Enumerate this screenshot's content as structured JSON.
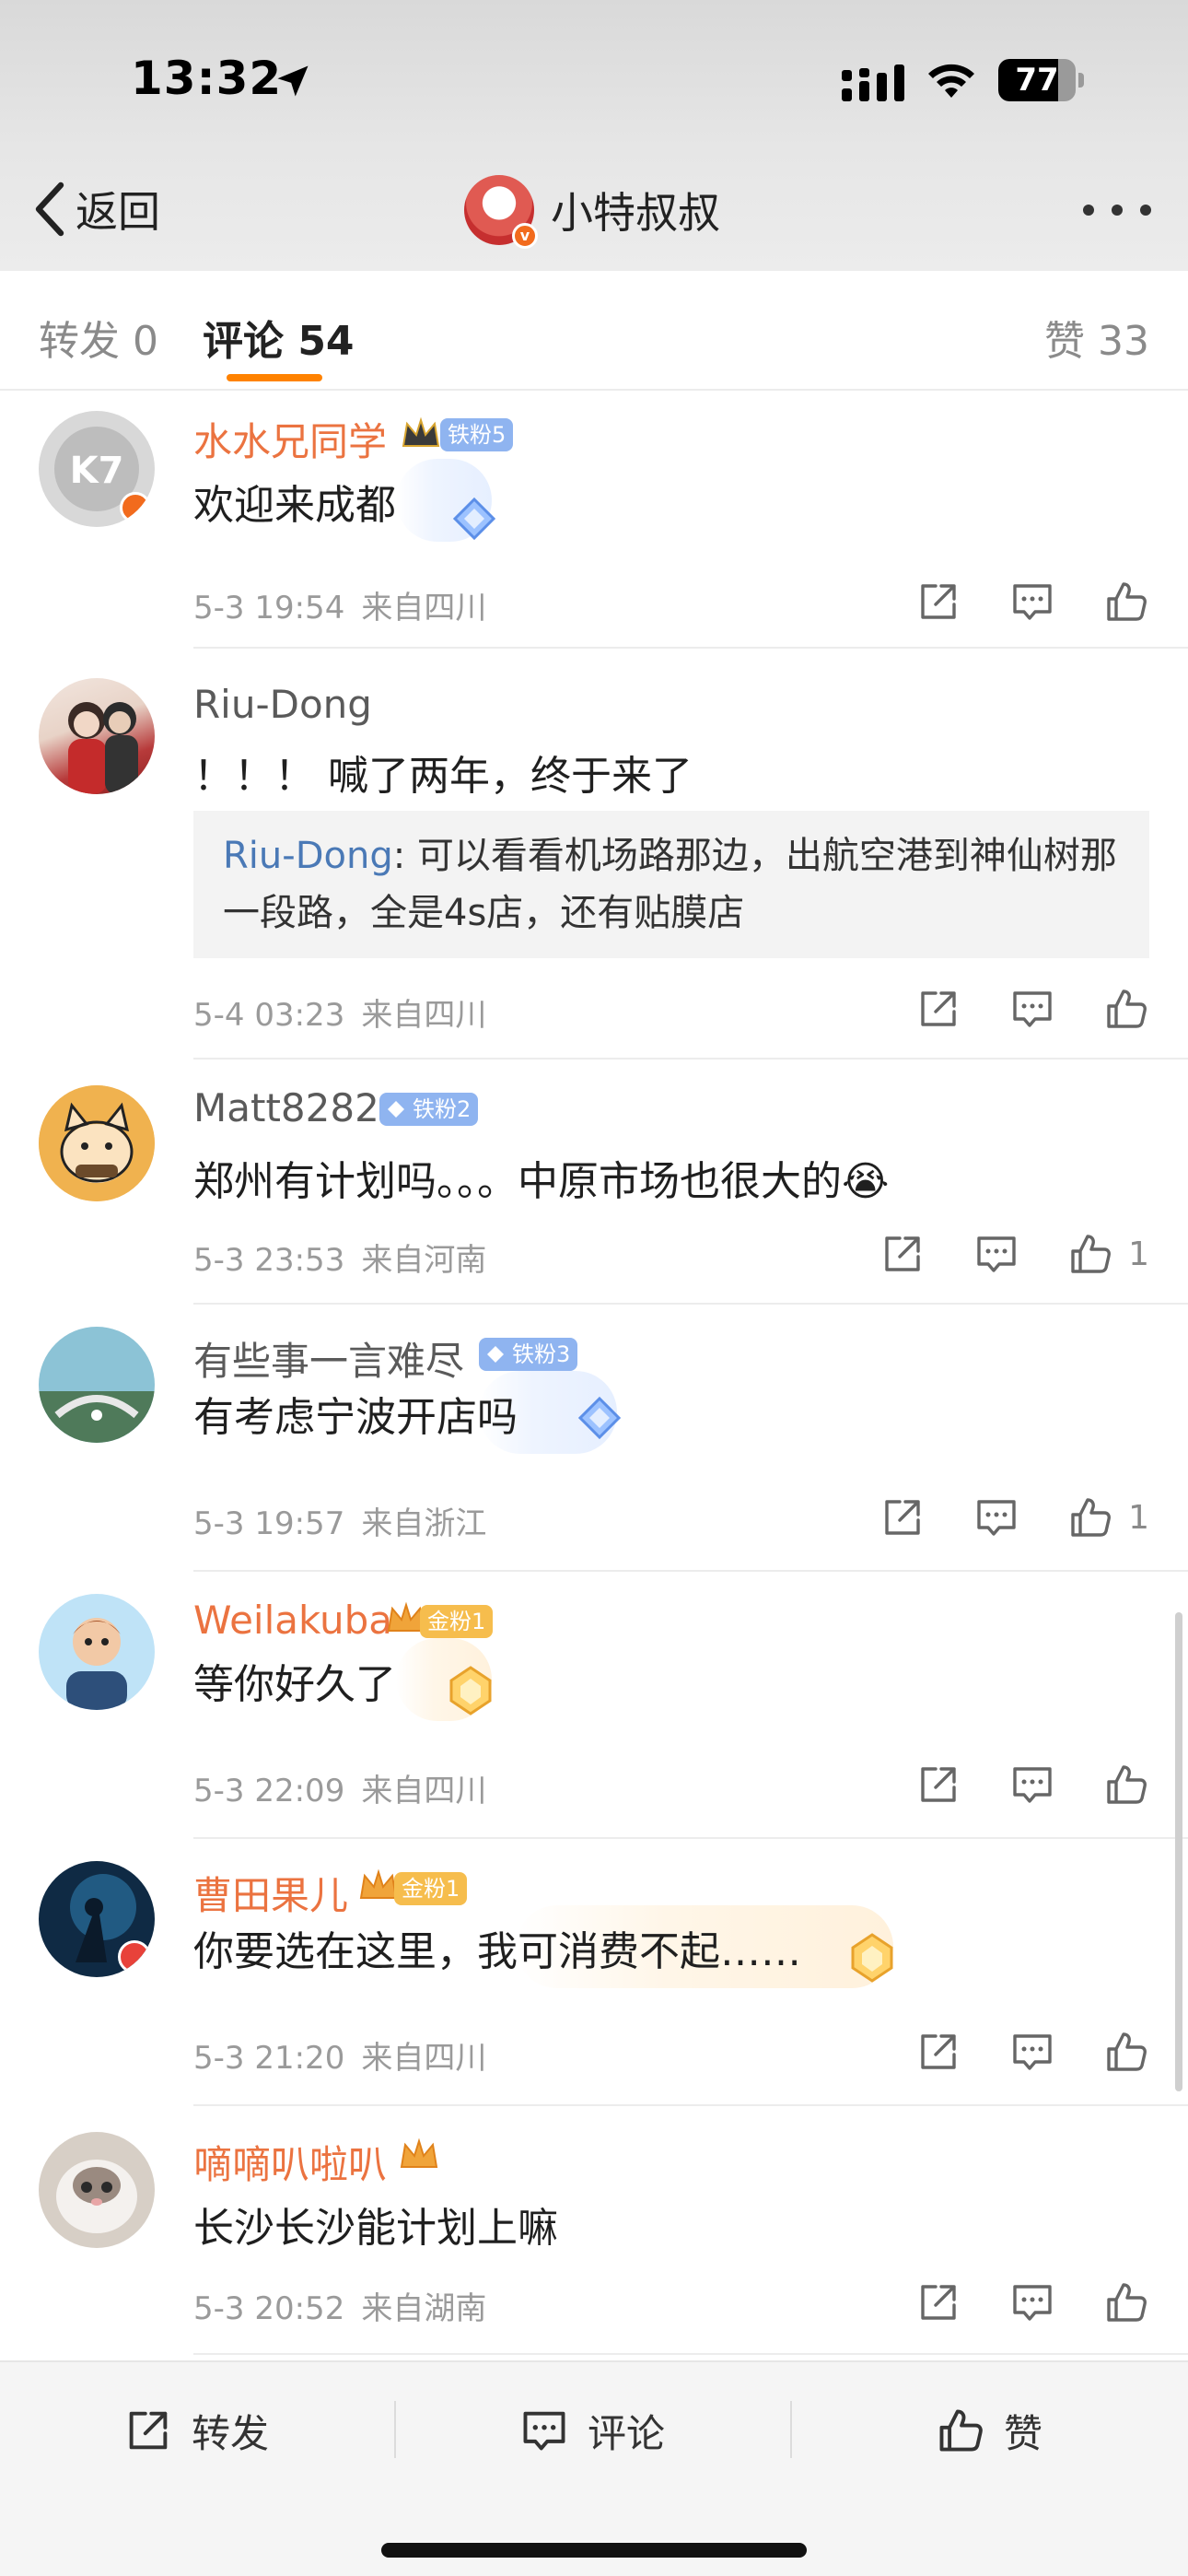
{
  "status_bar": {
    "time": "13:32",
    "battery": "77",
    "battery_level": 0.77
  },
  "nav": {
    "back_label": "返回",
    "title": "小特叔叔",
    "verified_mark": "v"
  },
  "tabs": {
    "repost": "转发 0",
    "comment": "评论 54",
    "like": "赞 33"
  },
  "comments": [
    {
      "user": "水水兄同学",
      "badge": "铁粉5",
      "text": "欢迎来成都",
      "time": "5-3 19:54",
      "location": "来自四川",
      "likes": ""
    },
    {
      "user": "Riu-Dong",
      "badge": "",
      "text": "！！！ 喊了两年，终于来了",
      "reply_user": "Riu-Dong",
      "reply_text": ": 可以看看机场路那边，出航空港到神仙树那一段路，全是4s店，还有贴膜店",
      "time": "5-4 03:23",
      "location": "来自四川",
      "likes": ""
    },
    {
      "user": "Matt8282",
      "badge": "铁粉2",
      "text": "郑州有计划吗。。。中原市场也很大的😭",
      "time": "5-3 23:53",
      "location": "来自河南",
      "likes": "1"
    },
    {
      "user": "有些事一言难尽",
      "badge": "铁粉3",
      "text": "有考虑宁波开店吗",
      "time": "5-3 19:57",
      "location": "来自浙江",
      "likes": "1"
    },
    {
      "user": "Weilakuba",
      "badge": "金粉1",
      "text": "等你好久了",
      "time": "5-3 22:09",
      "location": "来自四川",
      "likes": ""
    },
    {
      "user": "曹田果儿",
      "badge": "金粉1",
      "text": "你要选在这里，我可消费不起……",
      "time": "5-3 21:20",
      "location": "来自四川",
      "likes": ""
    },
    {
      "user": "嘀嘀叭啦叭",
      "badge": "",
      "text": "长沙长沙能计划上嘛",
      "time": "5-3 20:52",
      "location": "来自湖南",
      "likes": ""
    }
  ],
  "bottom_bar": {
    "repost": "转发",
    "comment": "评论",
    "like": "赞"
  },
  "colors": {
    "accent": "#ff8200",
    "username_orange": "#eb7340",
    "quote_blue": "#4a79b6",
    "iron_badge": "#8fb4f0",
    "gold_badge": "#f6bd4d"
  }
}
